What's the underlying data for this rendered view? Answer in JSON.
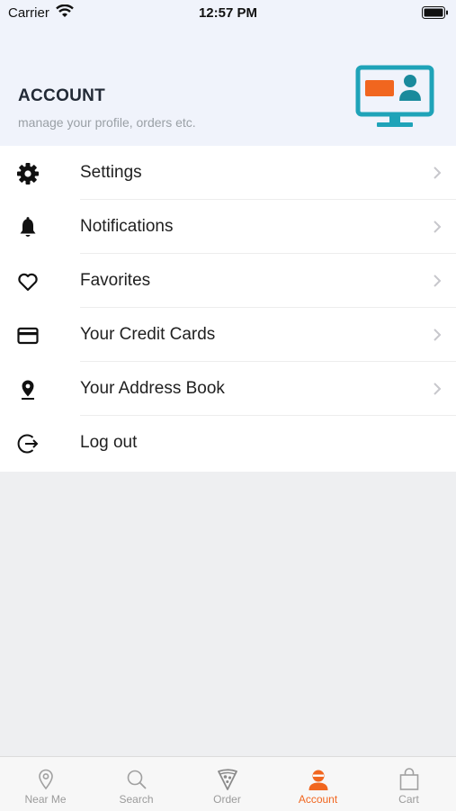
{
  "status_bar": {
    "carrier": "Carrier",
    "time": "12:57 PM"
  },
  "header": {
    "title": "ACCOUNT",
    "subtitle": "manage your profile, orders etc.",
    "illustration_icon": "computer-profile-icon"
  },
  "menu": {
    "items": [
      {
        "label": "Settings",
        "icon": "gear-icon",
        "chevron": true
      },
      {
        "label": "Notifications",
        "icon": "bell-icon",
        "chevron": true
      },
      {
        "label": "Favorites",
        "icon": "heart-icon",
        "chevron": true
      },
      {
        "label": "Your Credit Cards",
        "icon": "credit-card-icon",
        "chevron": true
      },
      {
        "label": "Your Address Book",
        "icon": "location-pin-icon",
        "chevron": true
      },
      {
        "label": "Log out",
        "icon": "logout-icon",
        "chevron": false
      }
    ]
  },
  "tab_bar": {
    "tabs": [
      {
        "label": "Near Me",
        "icon": "location-pin-icon",
        "active": false
      },
      {
        "label": "Search",
        "icon": "search-icon",
        "active": false
      },
      {
        "label": "Order",
        "icon": "pizza-icon",
        "active": false
      },
      {
        "label": "Account",
        "icon": "user-icon",
        "active": true
      },
      {
        "label": "Cart",
        "icon": "shopping-bag-icon",
        "active": false
      }
    ]
  },
  "colors": {
    "accent": "#f1661f",
    "header_bg": "#f0f3fb",
    "illustration_teal": "#1fa3b8",
    "page_bg": "#eeeff1"
  }
}
